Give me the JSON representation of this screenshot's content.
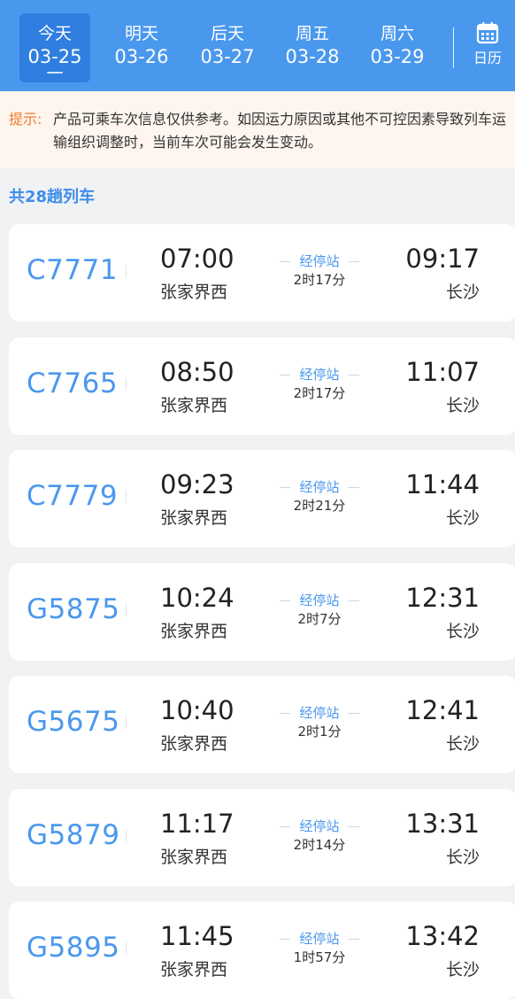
{
  "date_tabs": [
    {
      "weekday": "今天",
      "date": "03-25",
      "active": true
    },
    {
      "weekday": "明天",
      "date": "03-26",
      "active": false
    },
    {
      "weekday": "后天",
      "date": "03-27",
      "active": false
    },
    {
      "weekday": "周五",
      "date": "03-28",
      "active": false
    },
    {
      "weekday": "周六",
      "date": "03-29",
      "active": false
    }
  ],
  "calendar": {
    "label": "日历",
    "icon": "calendar-icon"
  },
  "notice": {
    "label": "提示:",
    "text": "产品可乘车次信息仅供参考。如因运力原因或其他不可控因素导致列车运输组织调整时，当前车次可能会发生变动。"
  },
  "count_text": "共28趟列车",
  "trains": [
    {
      "code": "C7771",
      "dep_time": "07:00",
      "dep_station": "张家界西",
      "stops_label": "经停站",
      "duration": "2时17分",
      "arr_time": "09:17",
      "arr_station": "长沙"
    },
    {
      "code": "C7765",
      "dep_time": "08:50",
      "dep_station": "张家界西",
      "stops_label": "经停站",
      "duration": "2时17分",
      "arr_time": "11:07",
      "arr_station": "长沙"
    },
    {
      "code": "C7779",
      "dep_time": "09:23",
      "dep_station": "张家界西",
      "stops_label": "经停站",
      "duration": "2时21分",
      "arr_time": "11:44",
      "arr_station": "长沙"
    },
    {
      "code": "G5875",
      "dep_time": "10:24",
      "dep_station": "张家界西",
      "stops_label": "经停站",
      "duration": "2时7分",
      "arr_time": "12:31",
      "arr_station": "长沙"
    },
    {
      "code": "G5675",
      "dep_time": "10:40",
      "dep_station": "张家界西",
      "stops_label": "经停站",
      "duration": "2时1分",
      "arr_time": "12:41",
      "arr_station": "长沙"
    },
    {
      "code": "G5879",
      "dep_time": "11:17",
      "dep_station": "张家界西",
      "stops_label": "经停站",
      "duration": "2时14分",
      "arr_time": "13:31",
      "arr_station": "长沙"
    },
    {
      "code": "G5895",
      "dep_time": "11:45",
      "dep_station": "张家界西",
      "stops_label": "经停站",
      "duration": "1时57分",
      "arr_time": "13:42",
      "arr_station": "长沙"
    }
  ],
  "colors": {
    "header_bg": "#4a98ee",
    "active_tab_bg": "#2f7ee0",
    "accent_blue": "#4a98ee",
    "notice_label": "#f07a2a",
    "notice_bg": "#fdf5ee",
    "page_bg": "#f1f2f4"
  }
}
